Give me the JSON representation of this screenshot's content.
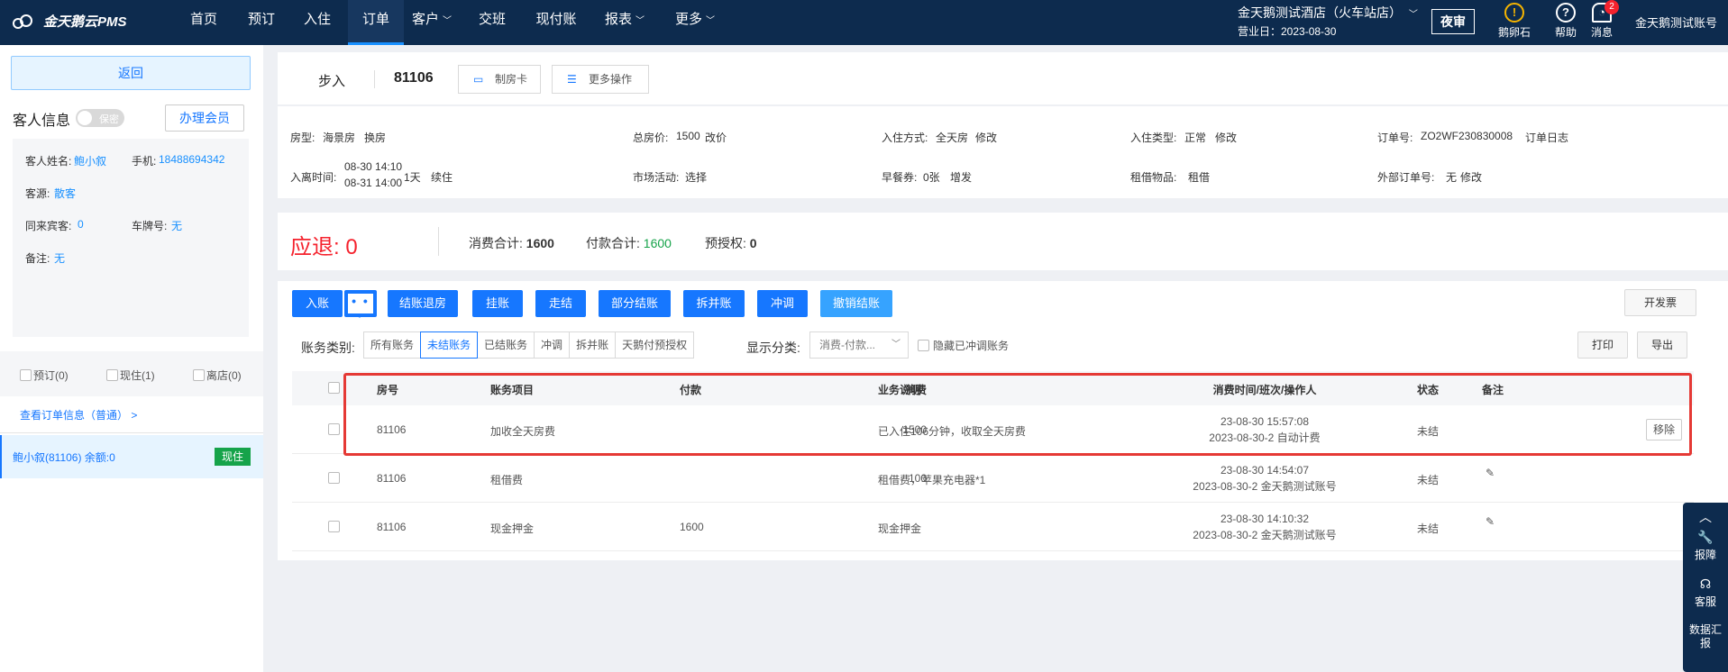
{
  "nav": {
    "brand": "金天鹅云PMS",
    "items": [
      "首页",
      "预订",
      "入住",
      "订单",
      "客户",
      "交班",
      "现付账",
      "报表",
      "更多"
    ],
    "hotel_name": "金天鹅测试酒店（火车站店）",
    "business_date": "营业日：2023-08-30",
    "night_audit": "夜审",
    "icons": [
      {
        "label": "鹅卵石",
        "glyph": "!"
      },
      {
        "label": "帮助",
        "glyph": "?"
      },
      {
        "label": "消息",
        "glyph": "◔",
        "badge": "2"
      }
    ],
    "account": "金天鹅测试账号"
  },
  "left": {
    "back": "返回",
    "guest_title": "客人信息",
    "privacy_toggle": "保密",
    "member_button": "办理会员",
    "guest_name_label": "客人姓名:",
    "guest_name": "鲍小叙",
    "phone_label": "手机:",
    "phone": "18488694342",
    "source_label": "客源:",
    "source": "散客",
    "companions_label": "同来宾客:",
    "companions": "0",
    "plate_label": "车牌号:",
    "plate": "无",
    "remark_label": "备注:",
    "remark": "无",
    "filters": [
      "预订(0)",
      "现住(1)",
      "离店(0)"
    ],
    "view_order": "查看订单信息（普通）  >",
    "guest_row": "鲍小叙(81106)  余额:0",
    "status": "现住"
  },
  "header": {
    "step": "步入",
    "room": "81106",
    "make_card": "制房卡",
    "more_ops": "更多操作"
  },
  "info": {
    "room_type_label": "房型:",
    "room_type": "海景房",
    "change_room": "换房",
    "total_label": "总房价:",
    "total_price": "1500",
    "change_price": "改价",
    "checkin_method_label": "入住方式:",
    "checkin_method": "全天房",
    "edit": "修改",
    "checkin_type_label": "入住类型:",
    "checkin_type": "正常",
    "order_no_label": "订单号:",
    "order_no": "ZO2WF230830008",
    "order_log": "订单日志",
    "stay_label": "入离时间:",
    "arrive": "08-30 14:10",
    "depart": "08-31 14:00",
    "nights": "1天",
    "extend": "续住",
    "market_label": "市场活动:",
    "select": "选择",
    "breakfast_label": "早餐券:",
    "breakfast": "0张",
    "add_issue": "增发",
    "rental_label": "租借物品:",
    "rental": "租借",
    "ext_order_label": "外部订单号:",
    "ext_order": "无"
  },
  "summary": {
    "refund_label": "应退:",
    "refund": "0",
    "consume_label": "消费合计:",
    "consume": "1600",
    "payment_label": "付款合计:",
    "payment": "1600",
    "preauth_label": "预授权:",
    "preauth": "0"
  },
  "actions": {
    "post": "入账",
    "more": "• • •",
    "checkout": "结账退房",
    "hang": "挂账",
    "walk": "走结",
    "partial": "部分结账",
    "split_merge": "拆并账",
    "adjust": "冲调",
    "cancel_checkout": "撤销结账",
    "invoice": "开发票",
    "print": "打印",
    "export": "导出"
  },
  "filters": {
    "category_label": "账务类别:",
    "segments": [
      "所有账务",
      "未结账务",
      "已结账务",
      "冲调",
      "拆并账",
      "天鹅付预授权"
    ],
    "display_label": "显示分类:",
    "display_value": "消费-付款...",
    "hide_adjusted": "隐藏已冲调账务"
  },
  "table": {
    "headers": [
      "房号",
      "账务项目",
      "付款",
      "消费",
      "业务说明",
      "消费时间/班次/操作人",
      "状态",
      "备注"
    ],
    "rows": [
      {
        "room": "81106",
        "item": "加收全天房费",
        "payment": "",
        "consume": "1500",
        "desc": "已入住106分钟，收取全天房费",
        "time": "23-08-30 15:57:08",
        "shift": "2023-08-30-2 自动计费",
        "status": "未结",
        "action": "移除"
      },
      {
        "room": "81106",
        "item": "租借费",
        "payment": "",
        "consume": "100",
        "desc": "租借费，苹果充电器*1",
        "time": "23-08-30 14:54:07",
        "shift": "2023-08-30-2 金天鹅测试账号",
        "status": "未结",
        "action": ""
      },
      {
        "room": "81106",
        "item": "现金押金",
        "payment": "1600",
        "consume": "",
        "desc": "现金押金",
        "time": "23-08-30 14:10:32",
        "shift": "2023-08-30-2 金天鹅测试账号",
        "status": "未结",
        "action": ""
      }
    ]
  },
  "float_bar": [
    "报障",
    "客服",
    "数据汇报"
  ],
  "colors": {
    "nav_bg": "#0d2b4e",
    "accent": "#1677ff",
    "refund": "#f5222d",
    "status_green": "#16a34a",
    "highlight": "#e53935"
  }
}
